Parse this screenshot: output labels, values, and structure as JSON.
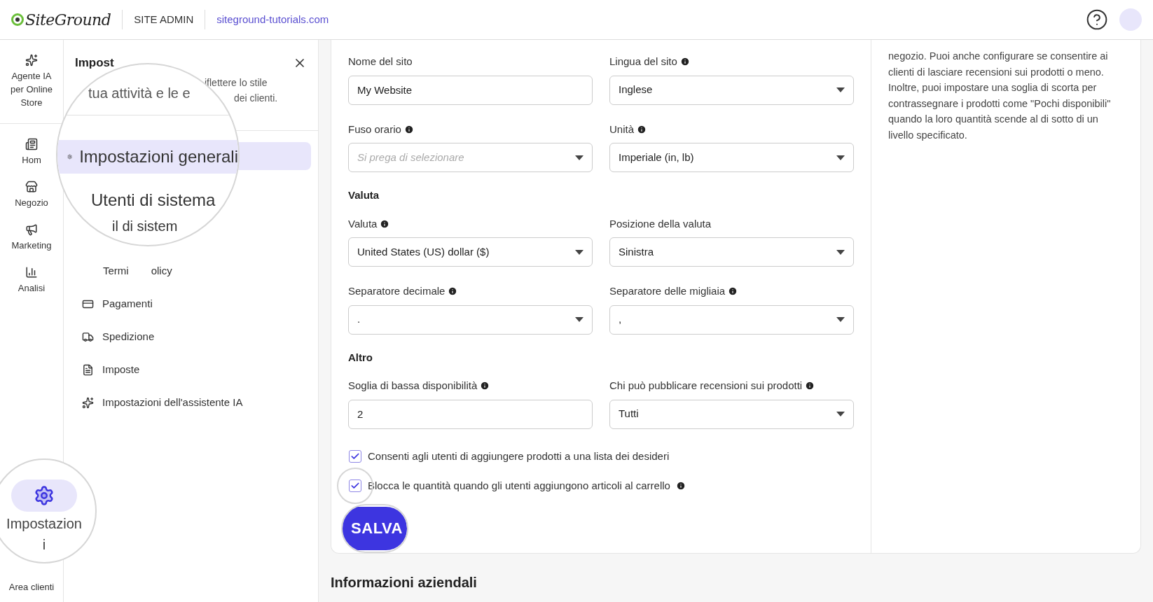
{
  "topbar": {
    "brand": "SiteGround",
    "section": "SITE ADMIN",
    "site_link": "siteground-tutorials.com"
  },
  "rail": {
    "items": [
      {
        "label": "Agente IA per Online Store"
      },
      {
        "label": "Hom"
      },
      {
        "label": "Negozio"
      },
      {
        "label": "Marketing"
      },
      {
        "label": "Analisi"
      }
    ],
    "magnified_item": {
      "label": "Impostazioni",
      "selected": true
    },
    "footer": "Area clienti"
  },
  "sidebar": {
    "title": "Impost",
    "description_lines": [
      "iflettere lo stile",
      "dei clienti."
    ],
    "magnifier": {
      "fragment": "tua attività e le e",
      "items": [
        {
          "label": "Impostazioni generali",
          "selected": true
        },
        {
          "label": "Utenti di sistema",
          "selected": false
        }
      ],
      "clipped_text": "il di sistem"
    },
    "partial_item": {
      "start": "Termi",
      "end": "olicy"
    },
    "items": [
      {
        "label": "Pagamenti",
        "selected": false
      },
      {
        "label": "Spedizione",
        "selected": false
      },
      {
        "label": "Imposte",
        "selected": false
      },
      {
        "label": "Impostazioni dell'assistente IA",
        "selected": false
      }
    ]
  },
  "form": {
    "sections": [
      {
        "fields": [
          {
            "label": "Nome del sito",
            "info": false,
            "kind": "text",
            "value": "My Website"
          },
          {
            "label": "Lingua del sito",
            "info": true,
            "kind": "select",
            "value": "Inglese"
          },
          {
            "label": "Fuso orario",
            "info": true,
            "kind": "select",
            "placeholder": "Si prega di selezionare"
          },
          {
            "label": "Unità",
            "info": true,
            "kind": "select",
            "value": "Imperiale (in, lb)"
          }
        ]
      },
      {
        "heading": "Valuta",
        "fields": [
          {
            "label": "Valuta",
            "info": true,
            "kind": "select",
            "value": "United States (US) dollar ($)"
          },
          {
            "label": "Posizione della valuta",
            "info": false,
            "kind": "select",
            "value": "Sinistra"
          },
          {
            "label": "Separatore decimale",
            "info": true,
            "kind": "select",
            "value": "."
          },
          {
            "label": "Separatore delle migliaia",
            "info": true,
            "kind": "select",
            "value": ","
          }
        ]
      },
      {
        "heading": "Altro",
        "fields": [
          {
            "label": "Soglia di bassa disponibilità",
            "info": true,
            "kind": "text",
            "value": "2"
          },
          {
            "label": "Chi può pubblicare recensioni sui prodotti",
            "info": true,
            "kind": "select",
            "value": "Tutti"
          }
        ]
      }
    ],
    "checkboxes": [
      {
        "label": "Consenti agli utenti di aggiungere prodotti a una lista dei desideri",
        "checked": true,
        "info": false,
        "magnified": false
      },
      {
        "label": "Blocca le quantità quando gli utenti aggiungono articoli al carrello",
        "checked": true,
        "info": true,
        "magnified": true
      }
    ],
    "save_button": "SALVA"
  },
  "help_text": "negozio. Puoi anche configurare se consentire ai clienti di lasciare recensioni sui prodotti o meno. Inoltre, puoi impostare una soglia di scorta per contrassegnare i prodotti come \"Pochi disponibili\" quando la loro quantità scende al di sotto di un livello specificato.",
  "next_section": "Informazioni aziendali"
}
